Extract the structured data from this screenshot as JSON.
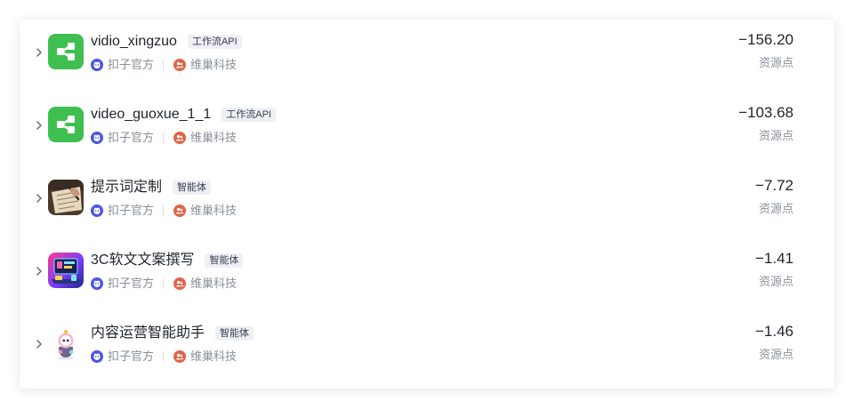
{
  "records": [
    {
      "title": "vidio_xingzuo",
      "tag": "工作流API",
      "icon": "workflow-icon",
      "author": "扣子官方",
      "team": "维巢科技",
      "amount": "−156.20",
      "unit": "资源点"
    },
    {
      "title": "video_guoxue_1_1",
      "tag": "工作流API",
      "icon": "workflow-icon",
      "author": "扣子官方",
      "team": "维巢科技",
      "amount": "−103.68",
      "unit": "资源点"
    },
    {
      "title": "提示词定制",
      "tag": "智能体",
      "icon": "handwriting-photo-icon",
      "author": "扣子官方",
      "team": "维巢科技",
      "amount": "−7.72",
      "unit": "资源点"
    },
    {
      "title": "3C软文文案撰写",
      "tag": "智能体",
      "icon": "3c-devices-icon",
      "author": "扣子官方",
      "team": "维巢科技",
      "amount": "−1.41",
      "unit": "资源点"
    },
    {
      "title": "内容运营智能助手",
      "tag": "智能体",
      "icon": "robot-mascot-icon",
      "author": "扣子官方",
      "team": "维巢科技",
      "amount": "−1.46",
      "unit": "资源点"
    }
  ],
  "colors": {
    "workflow_green": "#3fbf4f",
    "author_icon": "#4d53e8",
    "team_icon": "#e0644a",
    "tag_bg": "#eef0f5"
  }
}
